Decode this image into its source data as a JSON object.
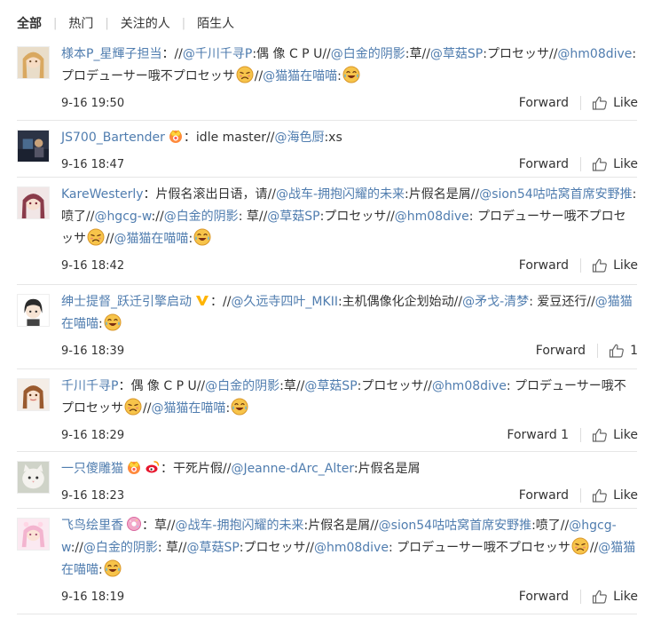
{
  "tabs": [
    {
      "label": "全部",
      "active": true
    },
    {
      "label": "热门",
      "active": false
    },
    {
      "label": "关注的人",
      "active": false
    },
    {
      "label": "陌生人",
      "active": false
    }
  ],
  "colors": {
    "link": "#507daf",
    "text": "#333333",
    "divider": "#e6e6e6"
  },
  "comments": [
    {
      "user": "様本P_星輝子担当",
      "badges": [],
      "text_html": "：//<a class=\"link\">@千川千寻P</a>:偶 像 C P U//<a class=\"link\">@白金的阴影</a>:草//<a class=\"link\">@草菇SP</a>:プロセッサ//<a class=\"link\">@hm08dive</a>: プロデューサー哦不プロセッサ[em:sad]//<a class=\"link\">@猫猫在喵喵</a>:[em:laugh]",
      "time": "9-16 19:50",
      "forward": "Forward",
      "like": "Like",
      "avatar": "anime-girl-blonde"
    },
    {
      "user": "JS700_Bartender",
      "badges": [
        "vip-crown"
      ],
      "text_html": "：idle master//<a class=\"link\">@海色厨</a>:xs",
      "time": "9-16 18:47",
      "forward": "Forward",
      "like": "Like",
      "avatar": "dark-scene"
    },
    {
      "user": "KareWesterly",
      "badges": [],
      "text_html": "：片假名滚出日语，请//<a class=\"link\">@战车-拥抱闪耀的未来</a>:片假名是屑//<a class=\"link\">@sion54咕咕窝首席安野推</a>:喷了//<a class=\"link\">@hgcg-w</a>://<a class=\"link\">@白金的阴影</a>: 草//<a class=\"link\">@草菇SP</a>:プロセッサ//<a class=\"link\">@hm08dive</a>: プロデューサー哦不プロセッサ[em:sad]//<a class=\"link\">@猫猫在喵喵</a>:[em:laugh]",
      "time": "9-16 18:42",
      "forward": "Forward",
      "like": "Like",
      "avatar": "anime-girl-red"
    },
    {
      "user": "绅士提督_跃迁引擎启动",
      "badges": [
        "verified-v"
      ],
      "text_html": "：//<a class=\"link\">@久远寺四叶_MKII</a>:主机偶像化企划始动//<a class=\"link\">@矛戈-清梦</a>: 爱豆还行//<a class=\"link\">@猫猫在喵喵</a>:[em:laugh]",
      "time": "9-16 18:39",
      "forward": "Forward",
      "like": "1",
      "avatar": "anime-boy-dark"
    },
    {
      "user": "千川千寻P",
      "badges": [],
      "text_html": "：偶 像 C P U//<a class=\"link\">@白金的阴影</a>:草//<a class=\"link\">@草菇SP</a>:プロセッサ//<a class=\"link\">@hm08dive</a>: プロデューサー哦不プロセッサ[em:sad]//<a class=\"link\">@猫猫在喵喵</a>:[em:laugh]",
      "time": "9-16 18:29",
      "forward": "Forward 1",
      "like": "Like",
      "avatar": "anime-girl-brown"
    },
    {
      "user": "一只傻雕猫",
      "badges": [
        "vip-crown",
        "weibo-logo"
      ],
      "text_html": "：干死片假//<a class=\"link\">@Jeanne-dArc_Alter</a>:片假名是屑",
      "time": "9-16 18:23",
      "forward": "Forward",
      "like": "Like",
      "avatar": "white-cat"
    },
    {
      "user": "飞鸟绘里香",
      "badges": [
        "donut"
      ],
      "text_html": "：草//<a class=\"link\">@战车-拥抱闪耀的未来</a>:片假名是屑//<a class=\"link\">@sion54咕咕窝首席安野推</a>:喷了//<a class=\"link\">@hgcg-w</a>://<a class=\"link\">@白金的阴影</a>: 草//<a class=\"link\">@草菇SP</a>:プロセッサ//<a class=\"link\">@hm08dive</a>: プロデューサー哦不プロセッサ[em:sad]//<a class=\"link\">@猫猫在喵喵</a>:[em:laugh]",
      "time": "9-16 18:19",
      "forward": "Forward",
      "like": "Like",
      "avatar": "anime-girl-pink"
    }
  ]
}
